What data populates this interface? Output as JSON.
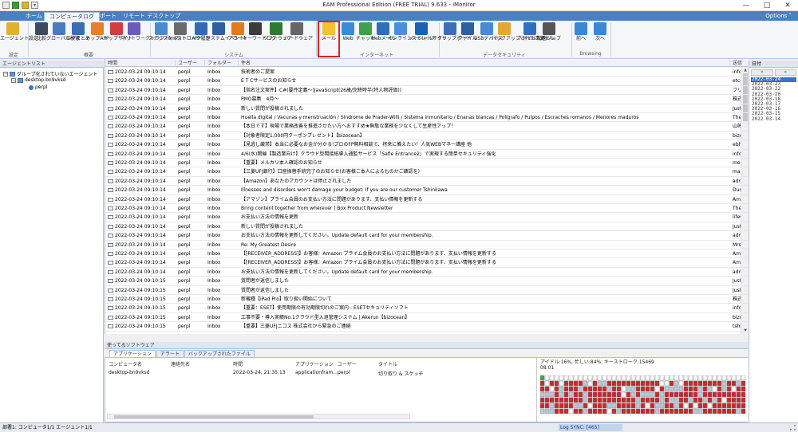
{
  "window": {
    "title": "EAM Professional Edition (FREE TRIAL) 9.633 - iMonitor",
    "minimize": "—",
    "maximize": "□",
    "close": "✕"
  },
  "ribbon": {
    "tabs": [
      "ホーム",
      "コンピュータログ",
      "レポート",
      "リモート デスクトップ"
    ],
    "options": "Options ˅",
    "buttons": [
      {
        "label": "エージェント設定",
        "color": "#e0b030"
      },
      {
        "label": "比較",
        "color": "#3b4a5e"
      },
      {
        "label": "グローバル検索",
        "color": "#4a7bc1"
      },
      {
        "label": "ログまとめ",
        "color": "#3a6db5"
      },
      {
        "label": "トップAPP",
        "color": "#e8802a"
      },
      {
        "label": "トップサイト",
        "color": "#d23d3d"
      },
      {
        "label": "ネットワークトラフィック",
        "color": "#6b5bb8"
      },
      {
        "label": "スナップショット",
        "color": "#4a8bd0"
      },
      {
        "label": "キーストローク",
        "color": "#6a6a6a"
      },
      {
        "label": "APP履歴",
        "color": "#3569b4"
      },
      {
        "label": "システムイベント",
        "color": "#2f5f9e"
      },
      {
        "label": "アラート",
        "color": "#e27b1c"
      },
      {
        "label": "キーワードログ",
        "color": "#3b3b3b"
      },
      {
        "label": "ソフトウェア",
        "color": "#2f7a2f"
      },
      {
        "label": "ハードウェア",
        "color": "#666"
      },
      {
        "label": "メール",
        "color": "#f1c232"
      },
      {
        "label": "Web",
        "color": "#3b8ad8"
      },
      {
        "label": "チャット",
        "color": "#3f9f4f"
      },
      {
        "label": "Webメール",
        "color": "#2f6fb8"
      },
      {
        "label": "オンラインストレージ",
        "color": "#4a90d9"
      },
      {
        "label": "ソーシャルサイト",
        "color": "#1b5fb0"
      },
      {
        "label": "クリップボード",
        "color": "#3d6eb5"
      },
      {
        "label": "ファイル",
        "color": "#2b5f9e"
      },
      {
        "label": "USBデバイス",
        "color": "#4a8ad0"
      },
      {
        "label": "バックアップされたファイル",
        "color": "#e2a830"
      },
      {
        "label": "ファイル転送",
        "color": "#3070c0"
      },
      {
        "label": "印刷ジョブ",
        "color": "#555"
      },
      {
        "label": "前へ",
        "color": "#3c86d6"
      },
      {
        "label": "次へ",
        "color": "#3c86d6"
      }
    ],
    "groups": [
      "設定",
      "概要",
      "システム",
      "インターネット",
      "データセキュリティ",
      "Browsing"
    ]
  },
  "agents": {
    "header": "エージェントリスト",
    "tree": [
      "グループ化されていないエージェント",
      "desktop-bn9vksd",
      "perpl"
    ]
  },
  "grid": {
    "columns": [
      "時間",
      "ユーザー",
      "フォルダー",
      "件名",
      "送信"
    ],
    "rows": [
      {
        "time": "2022-03-24 09:10:14",
        "user": "perpl",
        "folder": "Inbox",
        "subject": "技術者のご提案",
        "from": "info2"
      },
      {
        "time": "2022-03-24 09:10:14",
        "user": "perpl",
        "folder": "Inbox",
        "subject": "E T Cサービスのお知らせ",
        "from": "etc-"
      },
      {
        "time": "2022-03-24 09:10:14",
        "user": "perpl",
        "folder": "Inbox",
        "subject": "【指名注文案件】C#(要件定義～)JavaScript(26歳/完終時半(特人物評価))",
        "from": "フリ"
      },
      {
        "time": "2022-03-24 09:10:14",
        "user": "perpl",
        "folder": "Inbox",
        "subject": "PMO募集　4月～",
        "from": "株式"
      },
      {
        "time": "2022-03-24 09:10:14",
        "user": "perpl",
        "folder": "Inbox",
        "subject": "新しい質問が投稿されました",
        "from": "Just"
      },
      {
        "time": "2022-03-24 09:10:14",
        "user": "perpl",
        "folder": "Inbox",
        "subject": "Huella digital / Vacunas y menstruación / Síndrome de Prader-Willi / Sistema inmunitario / Enanas blancas / Polígrafo / Pulpos / Escraches romanos / Menores maduros",
        "from": "The"
      },
      {
        "time": "2022-03-24 09:10:14",
        "user": "perpl",
        "folder": "Inbox",
        "subject": "【本日です】現場で業務改善を推進させたい方へおすすめ★無駄な業務を少なくして生産性アップ！",
        "from": "山崎"
      },
      {
        "time": "2022-03-24 09:10:14",
        "user": "perpl",
        "folder": "Inbox",
        "subject": "【対象者限定1,000円クーポンプレゼント】【bizocean】",
        "from": "bizoc"
      },
      {
        "time": "2022-03-24 09:10:14",
        "user": "perpl",
        "folder": "Inbox",
        "subject": "【見逃し厳禁】本当に必要なお金が分かる!プロのFP無料相談で、将来に備えたい！人気WEBマネー講座 他",
        "from": "ebh"
      },
      {
        "time": "2022-03-24 09:10:14",
        "user": "perpl",
        "folder": "Inbox",
        "subject": "4/6(水)開催【製造業向け】クラウド型間接紙導入通監サービス「Safie Entrance2」で実現する簡単セキュリティ強化",
        "from": "info"
      },
      {
        "time": "2022-03-24 09:10:14",
        "user": "perpl",
        "folder": "Inbox",
        "subject": "【重要】メルカリ本人確認のお知らせ",
        "from": "merc"
      },
      {
        "time": "2022-03-24 09:10:14",
        "user": "perpl",
        "folder": "Inbox",
        "subject": "【三菱UFJ銀行】口座振替手続完了のお知らせ(お客様ご本人によるものかご確認を)",
        "from": "mailX"
      },
      {
        "time": "2022-03-24 09:10:14",
        "user": "perpl",
        "folder": "Inbox",
        "subject": "【Amazon】あなたのアカウントは停止されました",
        "from": "admi"
      },
      {
        "time": "2022-03-24 09:10:14",
        "user": "perpl",
        "folder": "Inbox",
        "subject": "Illnesses and disorders won't damage your budget: If you are our customer Tshinkawa",
        "from": "Dunc"
      },
      {
        "time": "2022-03-24 09:10:14",
        "user": "perpl",
        "folder": "Inbox",
        "subject": "【アマゾン】プライム会員のお支払い方法に問題があります、支払い情報を更新する",
        "from": "Ama"
      },
      {
        "time": "2022-03-24 09:10:14",
        "user": "perpl",
        "folder": "Inbox",
        "subject": "Bring content together from wherever | Box Product Newsletter",
        "from": "The"
      },
      {
        "time": "2022-03-24 09:10:14",
        "user": "perpl",
        "folder": "Inbox",
        "subject": "お支払い方法の情報を更新",
        "from": "lifeG"
      },
      {
        "time": "2022-03-24 09:10:14",
        "user": "perpl",
        "folder": "Inbox",
        "subject": "新しい質問が投稿されました",
        "from": "Just"
      },
      {
        "time": "2022-03-24 09:10:14",
        "user": "perpl",
        "folder": "Inbox",
        "subject": "お支払い方法の情報を更新してください。Update default card for your membership.",
        "from": "admi"
      },
      {
        "time": "2022-03-24 09:10:14",
        "user": "perpl",
        "folder": "Inbox",
        "subject": "Re: My Greatest Desire",
        "from": "Mrs."
      },
      {
        "time": "2022-03-24 09:10:14",
        "user": "perpl",
        "folder": "Inbox",
        "subject": "【[RECEIVER_ADDRESS]】お客様：Amazon プライム会員のお支払い方法に問題があります、支払い情報を更新する",
        "from": "Ama"
      },
      {
        "time": "2022-03-24 09:10:14",
        "user": "perpl",
        "folder": "Inbox",
        "subject": "【[RECEIVER_ADDRESS]】お客様：Amazon プライム会員のお支払い方法に問題があります、支払い情報を更新する",
        "from": "Ama"
      },
      {
        "time": "2022-03-24 09:10:14",
        "user": "perpl",
        "folder": "Inbox",
        "subject": "お支払い方法の情報を更新してください。Update default card for your membership.",
        "from": "admi"
      },
      {
        "time": "2022-03-24 09:10:15",
        "user": "perpl",
        "folder": "Inbox",
        "subject": "質問者が返信しました",
        "from": "Just"
      },
      {
        "time": "2022-03-24 09:10:15",
        "user": "perpl",
        "folder": "Inbox",
        "subject": "質問者が返信しました",
        "from": "Just"
      },
      {
        "time": "2022-03-24 09:10:15",
        "user": "perpl",
        "folder": "Inbox",
        "subject": "新機種【iPad Pro】取り扱い開始について",
        "from": "株式"
      },
      {
        "time": "2022-03-24 09:10:15",
        "user": "perpl",
        "folder": "Inbox",
        "subject": "【重要：ESET】使用期限の有効期限切れのご案内 - ESETセキュリティソフト",
        "from": "info"
      },
      {
        "time": "2022-03-24 09:10:15",
        "user": "perpl",
        "folder": "Inbox",
        "subject": "工事不要・導入実績No.1クラウド型入退管理システム | Akerun【bizocean】",
        "from": "bizoc"
      },
      {
        "time": "2022-03-24 09:10:15",
        "user": "perpl",
        "folder": "Inbox",
        "subject": "【重要】三菱UFJニコス 株式会社から緊急のご連絡",
        "from": "tshin"
      }
    ]
  },
  "dates": {
    "header": "日付",
    "list": [
      "2022-03-24",
      "2022-03-23",
      "2022-03-22",
      "2022-03-20",
      "2022-03-18",
      "2022-03-17",
      "2022-03-16",
      "2022-03-15",
      "2022-03-14"
    ]
  },
  "bottom": {
    "header": "使ってるソフトウェア",
    "tabs": [
      "アプリケーション",
      "アラート",
      "バックアップされたファイル"
    ],
    "columns": [
      "コンピュータ名",
      "連絡先名",
      "時間",
      "アプリケーション",
      "ユーザー",
      "タイトル"
    ],
    "row": [
      "desktop-bn9vksd",
      "",
      "2022-03-24, 21:35:13",
      "applicationfram...",
      "perpl",
      "切り取り & スケッチ"
    ],
    "activity": "アイドル:16%, 忙しい:84%, キーストローク:15469",
    "activity_time": "08:01"
  },
  "status": {
    "left": "部署1: コンピュータ1/1 エージェント1/1",
    "sync": "Log SYNC: [465]"
  }
}
